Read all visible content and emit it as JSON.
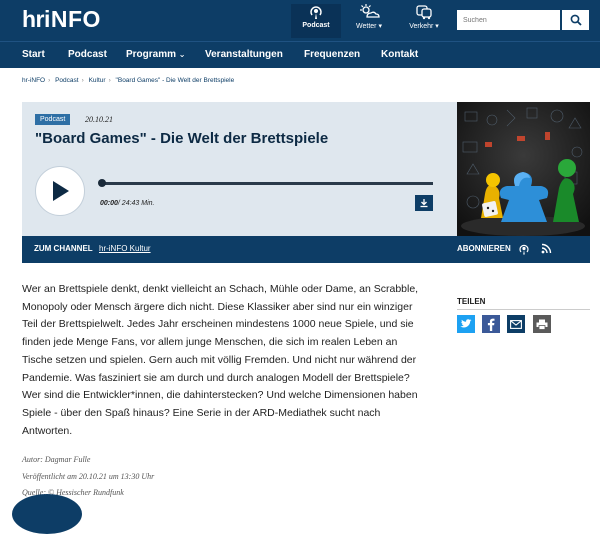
{
  "header": {
    "logo": {
      "hr": "hr",
      "info": "iNFO"
    },
    "icons": [
      {
        "label": "Podcast",
        "icon": "podcast-icon"
      },
      {
        "label": "Wetter",
        "icon": "weather-icon"
      },
      {
        "label": "Verkehr",
        "icon": "traffic-icon"
      }
    ],
    "search_placeholder": "Suchen"
  },
  "nav": [
    "Start",
    "Podcast",
    "Programm",
    "Veranstaltungen",
    "Frequenzen",
    "Kontakt"
  ],
  "breadcrumb": [
    "hr-iNFO",
    "Podcast",
    "Kultur",
    "\"Board Games\" - Die Welt der Brettspiele"
  ],
  "player": {
    "badge": "Podcast",
    "date": "20.10.21",
    "title": "\"Board Games\" - Die Welt der Brettspiele",
    "current_time": "00:00",
    "duration": "/ 24:43 Min.",
    "progress": 0
  },
  "channel": {
    "label": "ZUM CHANNEL",
    "name": "hr-iNFO Kultur",
    "subscribe": "ABONNIEREN"
  },
  "article": {
    "body": "Wer an Brettspiele denkt, denkt vielleicht an Schach, Mühle oder Dame, an Scrabble, Monopoly oder Mensch ärgere dich nicht. Diese Klassiker aber sind nur ein winziger Teil der Brettspielwelt. Jedes Jahr erscheinen mindestens 1000 neue Spiele, und sie finden jede Menge Fans, vor allem junge Menschen, die sich im realen Leben an Tische setzen und spielen. Gern auch mit völlig Fremden. Und nicht nur während der Pandemie. Was fasziniert sie am durch und durch analogen Modell der Brettspiele? Wer sind die Entwickler*innen, die dahinterstecken? Und welche Dimensionen haben Spiele - über den Spaß hinaus? Eine Serie in der ARD-Mediathek sucht nach Antworten.",
    "author": "Autor: Dagmar Fulle",
    "published": "Veröffentlicht am 20.10.21 um 13:30 Uhr",
    "source": "Quelle: © Hessischer Rundfunk"
  },
  "share": {
    "title": "TEILEN",
    "items": [
      "twitter-icon",
      "facebook-icon",
      "email-icon",
      "print-icon"
    ]
  },
  "colors": {
    "navy": "#0d3d66",
    "player_bg": "#dfe7ee",
    "badge": "#2e6fa5",
    "twitter": "#1da1f2",
    "facebook": "#3b5998"
  }
}
